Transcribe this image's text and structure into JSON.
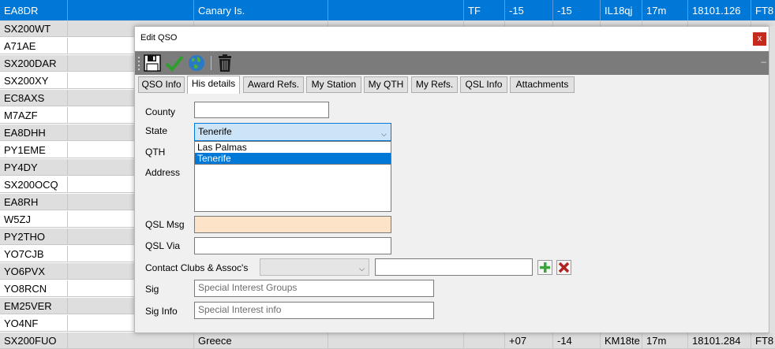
{
  "grid": {
    "rows": [
      {
        "call": "EA8DR",
        "country": "Canary Is.",
        "cont": "TF",
        "rst_s": "-15",
        "rst_r": "-15",
        "grid": "IL18qj",
        "band": "17m",
        "freq": "18101.126",
        "mode": "FT8",
        "style": "sel"
      },
      {
        "call": "SX200WT",
        "country": "",
        "cont": "",
        "rst_s": "",
        "rst_r": "",
        "grid": "",
        "band": "",
        "freq": "",
        "mode": "",
        "style": "alt"
      },
      {
        "call": "A71AE",
        "country": "",
        "cont": "",
        "rst_s": "",
        "rst_r": "",
        "grid": "",
        "band": "",
        "freq": "",
        "mode": "",
        "style": "white"
      },
      {
        "call": "SX200DAR",
        "country": "",
        "cont": "",
        "rst_s": "",
        "rst_r": "",
        "grid": "",
        "band": "",
        "freq": "",
        "mode": "",
        "style": "alt"
      },
      {
        "call": "SX200XY",
        "country": "",
        "cont": "",
        "rst_s": "",
        "rst_r": "",
        "grid": "",
        "band": "",
        "freq": "",
        "mode": "",
        "style": "white"
      },
      {
        "call": "EC8AXS",
        "country": "",
        "cont": "",
        "rst_s": "",
        "rst_r": "",
        "grid": "",
        "band": "",
        "freq": "",
        "mode": "",
        "style": "alt"
      },
      {
        "call": "M7AZF",
        "country": "",
        "cont": "",
        "rst_s": "",
        "rst_r": "",
        "grid": "",
        "band": "",
        "freq": "",
        "mode": "",
        "style": "white"
      },
      {
        "call": "EA8DHH",
        "country": "",
        "cont": "",
        "rst_s": "",
        "rst_r": "",
        "grid": "",
        "band": "",
        "freq": "",
        "mode": "",
        "style": "alt"
      },
      {
        "call": "PY1EME",
        "country": "",
        "cont": "",
        "rst_s": "",
        "rst_r": "",
        "grid": "",
        "band": "",
        "freq": "",
        "mode": "",
        "style": "white"
      },
      {
        "call": "PY4DY",
        "country": "",
        "cont": "",
        "rst_s": "",
        "rst_r": "",
        "grid": "",
        "band": "",
        "freq": "",
        "mode": "",
        "style": "alt"
      },
      {
        "call": "SX200OCQ",
        "country": "",
        "cont": "",
        "rst_s": "",
        "rst_r": "",
        "grid": "",
        "band": "",
        "freq": "",
        "mode": "",
        "style": "white"
      },
      {
        "call": "EA8RH",
        "country": "",
        "cont": "",
        "rst_s": "",
        "rst_r": "",
        "grid": "",
        "band": "",
        "freq": "",
        "mode": "",
        "style": "alt"
      },
      {
        "call": "W5ZJ",
        "country": "",
        "cont": "",
        "rst_s": "",
        "rst_r": "",
        "grid": "",
        "band": "",
        "freq": "",
        "mode": "",
        "style": "white"
      },
      {
        "call": "PY2THO",
        "country": "",
        "cont": "",
        "rst_s": "",
        "rst_r": "",
        "grid": "",
        "band": "",
        "freq": "",
        "mode": "",
        "style": "alt"
      },
      {
        "call": "YO7CJB",
        "country": "",
        "cont": "",
        "rst_s": "",
        "rst_r": "",
        "grid": "",
        "band": "",
        "freq": "",
        "mode": "",
        "style": "white"
      },
      {
        "call": "YO6PVX",
        "country": "",
        "cont": "",
        "rst_s": "",
        "rst_r": "",
        "grid": "",
        "band": "",
        "freq": "",
        "mode": "",
        "style": "alt"
      },
      {
        "call": "YO8RCN",
        "country": "",
        "cont": "",
        "rst_s": "",
        "rst_r": "",
        "grid": "",
        "band": "",
        "freq": "",
        "mode": "",
        "style": "white"
      },
      {
        "call": "EM25VER",
        "country": "",
        "cont": "",
        "rst_s": "",
        "rst_r": "",
        "grid": "",
        "band": "",
        "freq": "",
        "mode": "",
        "style": "alt"
      },
      {
        "call": "YO4NF",
        "country": "",
        "cont": "",
        "rst_s": "",
        "rst_r": "",
        "grid": "",
        "band": "",
        "freq": "",
        "mode": "",
        "style": "white"
      },
      {
        "call": "SX200FUO",
        "country": "Greece",
        "cont": "",
        "rst_s": "+07",
        "rst_r": "-14",
        "grid": "KM18te",
        "band": "17m",
        "freq": "18101.284",
        "mode": "FT8",
        "style": "alt"
      }
    ]
  },
  "dialog": {
    "title": "Edit QSO",
    "close_label": "x",
    "toolbar": {
      "icons": [
        "save-icon",
        "check-icon",
        "globe-icon",
        "trash-icon"
      ],
      "overflow_label": "–"
    },
    "tabs": [
      "QSO Info",
      "His details",
      "Award Refs.",
      "My Station",
      "My QTH",
      "My Refs.",
      "QSL Info",
      "Attachments"
    ],
    "active_tab": "His details",
    "form": {
      "county_label": "County",
      "county_value": "",
      "state_label": "State",
      "state_value": "Tenerife",
      "state_options": [
        "Las Palmas",
        "Tenerife"
      ],
      "qth_label": "QTH",
      "address_label": "Address",
      "qsl_msg_label": "QSL Msg",
      "qsl_via_label": "QSL Via",
      "clubs_label": "Contact Clubs & Assoc's",
      "sig_label": "Sig",
      "sig_placeholder": "Special Interest Groups",
      "sig_info_label": "Sig Info",
      "sig_info_placeholder": "Special Interest info"
    },
    "colors": {
      "accent": "#0078d7",
      "close": "#c42b1c",
      "toolbar": "#7b7b7b",
      "qsl_msg_bg": "#fde4c8"
    }
  }
}
